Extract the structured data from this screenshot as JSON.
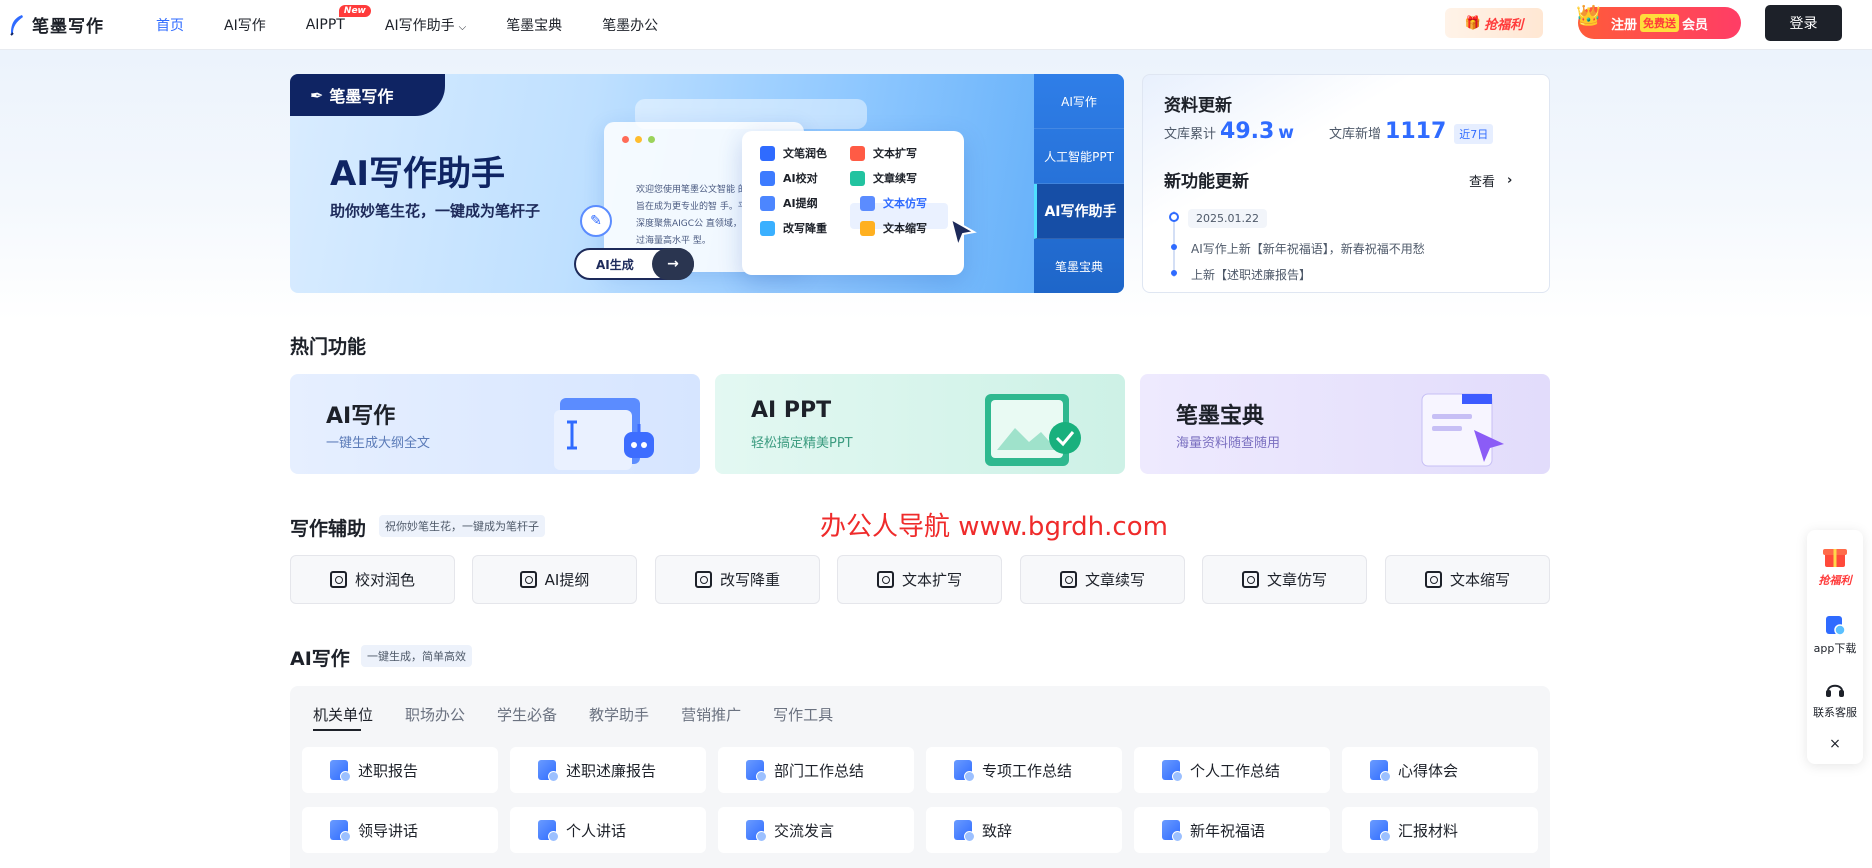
{
  "header": {
    "logo": "笔墨写作",
    "nav": [
      {
        "label": "首页",
        "active": true
      },
      {
        "label": "AI写作"
      },
      {
        "label": "AIPPT",
        "badge": "New"
      },
      {
        "label": "AI写作助手"
      },
      {
        "label": "笔墨宝典"
      },
      {
        "label": "笔墨办公"
      }
    ],
    "welfare": "抢福利",
    "register_a": "注册",
    "register_free": "免费送",
    "register_b": "会员",
    "login": "登录"
  },
  "banner": {
    "logo": "笔墨写作",
    "title": "AI写作助手",
    "subtitle": "助你妙笔生花，一键成为笔杆子",
    "doc_text": "欢迎您使用笔墨公文智能 的是旨在成为更专业的智 手。平台深度聚焦AIGC公 直领域，通过海量高水平 型。",
    "generate_label": "AI生成",
    "menu": [
      "文笔润色",
      "文本扩写",
      "AI校对",
      "文章续写",
      "AI提纲",
      "文本仿写",
      "改写降重",
      "文本缩写"
    ],
    "side_tabs": [
      "AI写作",
      "人工智能PPT",
      "AI写作助手",
      "笔墨宝典"
    ],
    "side_active": 2
  },
  "update": {
    "title": "资料更新",
    "total_label": "文库累计",
    "total_value": "49.3",
    "total_unit": "w",
    "new_label": "文库新增",
    "new_value": "1117",
    "new_tag": "近7日",
    "feature_title": "新功能更新",
    "view": "查看",
    "date": "2025.01.22",
    "lines": [
      "AI写作上新【新年祝福语】，新春祝福不用愁",
      "上新【述职述廉报告】"
    ]
  },
  "hot": {
    "title": "热门功能",
    "cards": [
      {
        "title": "AI写作",
        "sub": "一键生成大纲全文"
      },
      {
        "title": "AI PPT",
        "sub": "轻松搞定精美PPT"
      },
      {
        "title": "笔墨宝典",
        "sub": "海量资料随查随用"
      }
    ]
  },
  "aid": {
    "title": "写作辅助",
    "tag": "祝你妙笔生花，一键成为笔杆子",
    "items": [
      "校对润色",
      "AI提纲",
      "改写降重",
      "文本扩写",
      "文章续写",
      "文章仿写",
      "文本缩写"
    ]
  },
  "aiwrite": {
    "title": "AI写作",
    "tag": "一键生成，简单高效",
    "tabs": [
      "机关单位",
      "职场办公",
      "学生必备",
      "教学助手",
      "营销推广",
      "写作工具"
    ],
    "items": [
      "述职报告",
      "述职述廉报告",
      "部门工作总结",
      "专项工作总结",
      "个人工作总结",
      "心得体会",
      "领导讲话",
      "个人讲话",
      "交流发言",
      "致辞",
      "新年祝福语",
      "汇报材料"
    ]
  },
  "watermark": "办公人导航 www.bgrdh.com",
  "float": {
    "welfare": "抢福利",
    "app": "app下载",
    "service": "联系客服",
    "close": "×"
  },
  "colors": {
    "accent": "#2f6bff",
    "dark": "#1d2129",
    "red": "#ff3b3b"
  }
}
